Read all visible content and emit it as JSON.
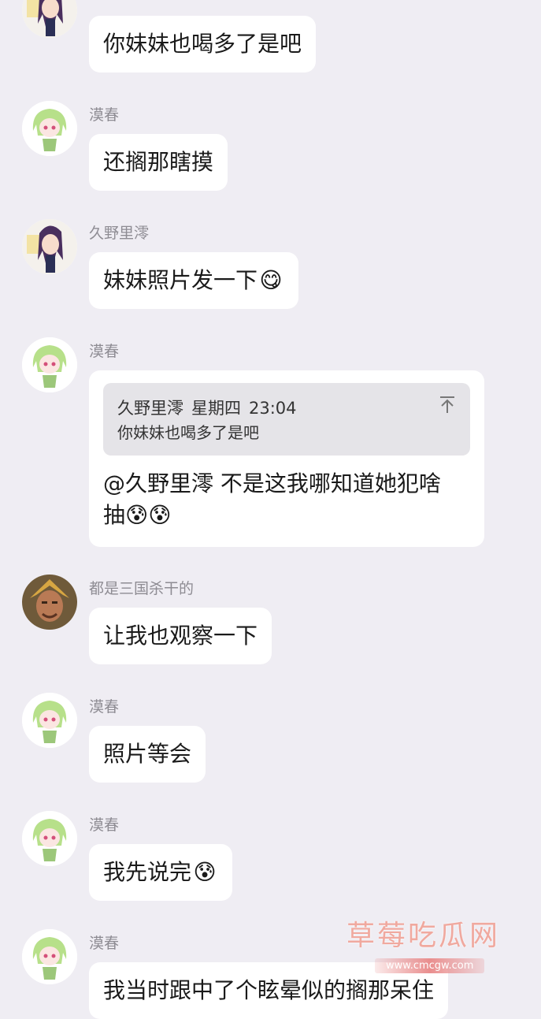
{
  "messages": [
    {
      "name": "",
      "avatar": "purple-hair-girl-avatar",
      "text": "你妹妹也喝多了是吧"
    },
    {
      "name": "漠春",
      "avatar": "green-hair-girl-avatar",
      "text": "还搁那瞎摸"
    },
    {
      "name": "久野里澪",
      "avatar": "purple-hair-girl-avatar",
      "text": "妹妹照片发一下",
      "emoji": "😋"
    },
    {
      "name": "漠春",
      "avatar": "green-hair-girl-avatar",
      "quote": {
        "sender": "久野里澪",
        "day": "星期四",
        "time": "23:04",
        "text": "你妹妹也喝多了是吧"
      },
      "text_line1": "@久野里澪 不是这我哪知道她犯啥",
      "text_line2": "抽",
      "emoji": "😰😰"
    },
    {
      "name": "都是三国杀干的",
      "avatar": "warrior-avatar",
      "text": "让我也观察一下"
    },
    {
      "name": "漠春",
      "avatar": "green-hair-girl-avatar",
      "text": "照片等会"
    },
    {
      "name": "漠春",
      "avatar": "green-hair-girl-avatar",
      "text": "我先说完",
      "emoji": "😰"
    },
    {
      "name": "漠春",
      "avatar": "green-hair-girl-avatar",
      "text": "我当时跟中了个眩晕似的搁那呆住"
    }
  ],
  "watermark": {
    "title": "草莓吃瓜网",
    "url": "www.cmcgw.com"
  },
  "colors": {
    "background": "#efedf3",
    "bubble": "#ffffff",
    "quote": "#e5e4e8",
    "name": "#8e8c93"
  }
}
